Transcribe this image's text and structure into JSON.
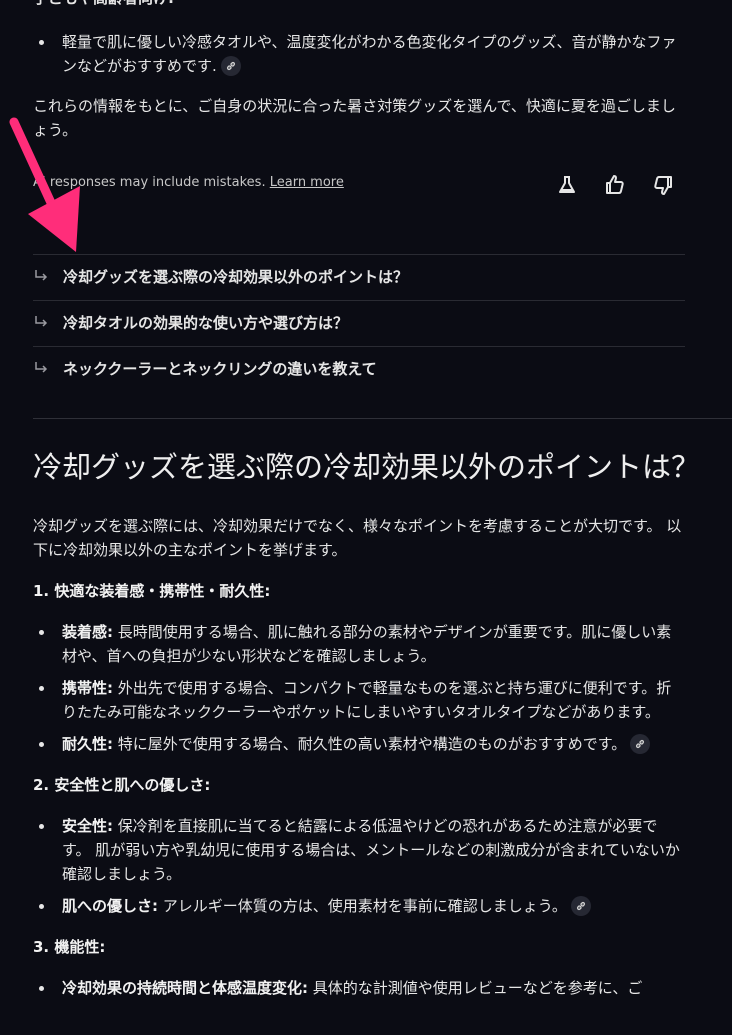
{
  "top": {
    "partial_heading": "子どもや高齢者向け:",
    "bullet1": "軽量で肌に優しい冷感タオルや、温度変化がわかる色変化タイプのグッズ、音が静かなファンなどがおすすめです.",
    "summary": "これらの情報をもとに、ご自身の状況に合った暑さ対策グッズを選んで、快適に夏を過ごしましょう。"
  },
  "feedback": {
    "disclaimer": "AI responses may include mistakes.",
    "learn_more": "Learn more"
  },
  "related": [
    {
      "label": "冷却グッズを選ぶ際の冷却効果以外のポイントは？"
    },
    {
      "label": "冷却タオルの効果的な使い方や選び方は？"
    },
    {
      "label": "ネッククーラーとネックリングの違いを教えて"
    }
  ],
  "answer": {
    "title": "冷却グッズを選ぶ際の冷却効果以外のポイントは？",
    "intro": "冷却グッズを選ぶ際には、冷却効果だけでなく、様々なポイントを考慮することが大切です。 以下に冷却効果以外の主なポイントを挙げます。",
    "sections": [
      {
        "heading": "1. 快適な装着感・携帯性・耐久性:",
        "items": [
          {
            "term": "装着感:",
            "text": " 長時間使用する場合、肌に触れる部分の素材やデザインが重要です。肌に優しい素材や、首への負担が少ない形状などを確認しましょう。"
          },
          {
            "term": "携帯性:",
            "text": " 外出先で使用する場合、コンパクトで軽量なものを選ぶと持ち運びに便利です。折りたたみ可能なネッククーラーやポケットにしまいやすいタオルタイプなどがあります。"
          },
          {
            "term": "耐久性:",
            "text": " 特に屋外で使用する場合、耐久性の高い素材や構造のものがおすすめです。"
          }
        ]
      },
      {
        "heading": "2. 安全性と肌への優しさ:",
        "items": [
          {
            "term": "安全性:",
            "text": " 保冷剤を直接肌に当てると結露による低温やけどの恐れがあるため注意が必要です。 肌が弱い方や乳幼児に使用する場合は、メントールなどの刺激成分が含まれていないか確認しましょう。"
          },
          {
            "term": "肌への優しさ:",
            "text": " アレルギー体質の方は、使用素材を事前に確認しましょう。"
          }
        ]
      },
      {
        "heading": "3. 機能性:",
        "items": [
          {
            "term": "冷却効果の持続時間と体感温度変化:",
            "text": " 具体的な計測値や使用レビューなどを参考に、ご"
          }
        ]
      }
    ]
  },
  "colors": {
    "background": "#0b0c14",
    "annotation_arrow": "#ff2d7a"
  }
}
